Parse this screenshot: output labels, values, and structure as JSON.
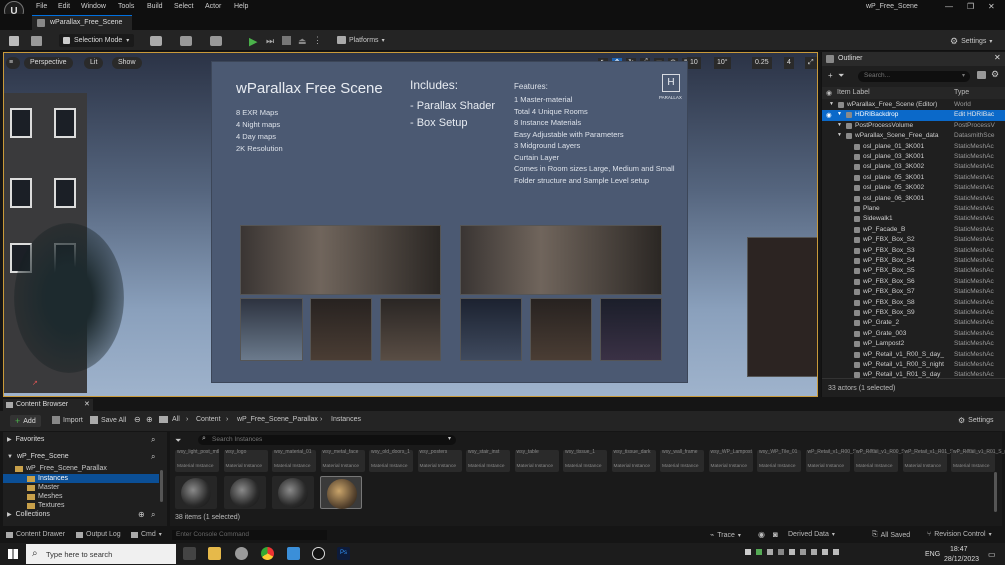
{
  "menu": [
    "File",
    "Edit",
    "Window",
    "Tools",
    "Build",
    "Select",
    "Actor",
    "Help"
  ],
  "window_title": "wP_Free_Scene",
  "level_tab": "wParallax_Free_Scene",
  "toolbar": {
    "selection_mode": "Selection Mode",
    "platforms": "Platforms",
    "settings": "Settings"
  },
  "viewport": {
    "perspective": "Perspective",
    "lit": "Lit",
    "show": "Show",
    "grid_snap": "10",
    "rot_snap": "10°",
    "scale_snap": "0.25",
    "cam_speed": "4",
    "board": {
      "title": "wParallax Free Scene",
      "maps": [
        "8 EXR Maps",
        "4 Night maps",
        "4 Day maps",
        "2K Resolution"
      ],
      "includes_title": "Includes:",
      "includes": [
        "- Parallax Shader",
        "- Box Setup"
      ],
      "features_title": "Features:",
      "features": [
        "1 Master-material",
        "Total 4 Unique Rooms",
        "8 Instance Materials",
        "Easy Adjustable with Parameters",
        "3 Midground Layers",
        "Curtain Layer",
        "Comes in Room sizes Large, Medium and Small",
        "Folder structure and Sample Level setup"
      ],
      "logo_text": "PARALLAX"
    }
  },
  "outliner": {
    "title": "Outliner",
    "search_placeholder": "Search...",
    "col_label": "Item Label",
    "col_type": "Type",
    "rows": [
      {
        "label": "wParallax_Free_Scene (Editor)",
        "type": "World",
        "indent": 1,
        "selected": false
      },
      {
        "label": "HDRIBackdrop",
        "type": "Edit HDRIBac",
        "indent": 2,
        "selected": true
      },
      {
        "label": "PostProcessVolume",
        "type": "PostProcessV",
        "indent": 2,
        "selected": false
      },
      {
        "label": "wParallax_Scene_Free_data",
        "type": "DatasmithSce",
        "indent": 2,
        "selected": false
      },
      {
        "label": "osl_plane_01_3K001",
        "type": "StaticMeshAc",
        "indent": 3,
        "selected": false
      },
      {
        "label": "osl_plane_03_3K001",
        "type": "StaticMeshAc",
        "indent": 3,
        "selected": false
      },
      {
        "label": "osl_plane_03_3K002",
        "type": "StaticMeshAc",
        "indent": 3,
        "selected": false
      },
      {
        "label": "osl_plane_05_3K001",
        "type": "StaticMeshAc",
        "indent": 3,
        "selected": false
      },
      {
        "label": "osl_plane_05_3K002",
        "type": "StaticMeshAc",
        "indent": 3,
        "selected": false
      },
      {
        "label": "osl_plane_06_3K001",
        "type": "StaticMeshAc",
        "indent": 3,
        "selected": false
      },
      {
        "label": "Plane",
        "type": "StaticMeshAc",
        "indent": 3,
        "selected": false
      },
      {
        "label": "Sidewalk1",
        "type": "StaticMeshAc",
        "indent": 3,
        "selected": false
      },
      {
        "label": "wP_Facade_B",
        "type": "StaticMeshAc",
        "indent": 3,
        "selected": false
      },
      {
        "label": "wP_FBX_Box_S2",
        "type": "StaticMeshAc",
        "indent": 3,
        "selected": false
      },
      {
        "label": "wP_FBX_Box_S3",
        "type": "StaticMeshAc",
        "indent": 3,
        "selected": false
      },
      {
        "label": "wP_FBX_Box_S4",
        "type": "StaticMeshAc",
        "indent": 3,
        "selected": false
      },
      {
        "label": "wP_FBX_Box_S5",
        "type": "StaticMeshAc",
        "indent": 3,
        "selected": false
      },
      {
        "label": "wP_FBX_Box_S6",
        "type": "StaticMeshAc",
        "indent": 3,
        "selected": false
      },
      {
        "label": "wP_FBX_Box_S7",
        "type": "StaticMeshAc",
        "indent": 3,
        "selected": false
      },
      {
        "label": "wP_FBX_Box_S8",
        "type": "StaticMeshAc",
        "indent": 3,
        "selected": false
      },
      {
        "label": "wP_FBX_Box_S9",
        "type": "StaticMeshAc",
        "indent": 3,
        "selected": false
      },
      {
        "label": "wP_Grate_2",
        "type": "StaticMeshAc",
        "indent": 3,
        "selected": false
      },
      {
        "label": "wP_Grate_003",
        "type": "StaticMeshAc",
        "indent": 3,
        "selected": false
      },
      {
        "label": "wP_Lampost2",
        "type": "StaticMeshAc",
        "indent": 3,
        "selected": false
      },
      {
        "label": "wP_Retail_v1_R00_S_day_",
        "type": "StaticMeshAc",
        "indent": 3,
        "selected": false
      },
      {
        "label": "wP_Retail_v1_R00_S_night",
        "type": "StaticMeshAc",
        "indent": 3,
        "selected": false
      },
      {
        "label": "wP_Retail_v1_R01_S_day",
        "type": "StaticMeshAc",
        "indent": 3,
        "selected": false
      }
    ],
    "actor_count": "33 actors (1 selected)"
  },
  "content_browser": {
    "tab": "Content Browser",
    "add": "Add",
    "import": "Import",
    "save_all": "Save All",
    "path": [
      "All",
      "Content",
      "wP_Free_Scene_Parallax",
      "Instances"
    ],
    "settings": "Settings",
    "favorites": "Favorites",
    "root": "wP_Free_Scene",
    "tree": [
      "wP_Free_Scene_Parallax",
      "Instances",
      "Master",
      "Meshes",
      "Textures"
    ],
    "collections": "Collections",
    "search_placeholder": "Search Instances",
    "asset_names": [
      "wsy_light_post_mtl",
      "wsy_logo",
      "wsy_material_01",
      "wsy_metal_face",
      "wsy_old_doors_1",
      "wsy_posters",
      "wsy_stair_inst",
      "wsy_table",
      "wsy_tissue_1",
      "wsy_tissue_dark",
      "wsy_wall_frame",
      "wsy_WP_Lampost",
      "wsy_WP_Tile_01",
      "wP_Retail_v1_R00_S_day_2K",
      "wP_Retail_v1_R00_S_night",
      "wP_Retail_v1_R01_S_day_2K",
      "wP_Retail_v1_R01_S_night"
    ],
    "asset_kind": "Material Instance",
    "item_count": "38 items (1 selected)"
  },
  "statusbar": {
    "drawer": "Content Drawer",
    "output_log": "Output Log",
    "cmd": "Cmd",
    "console_placeholder": "Enter Console Command",
    "trace": "Trace",
    "derived": "Derived Data",
    "saved": "All Saved",
    "revision": "Revision Control"
  },
  "taskbar": {
    "search": "Type here to search",
    "lang": "ENG",
    "time": "18:47",
    "date": "28/12/2023"
  }
}
